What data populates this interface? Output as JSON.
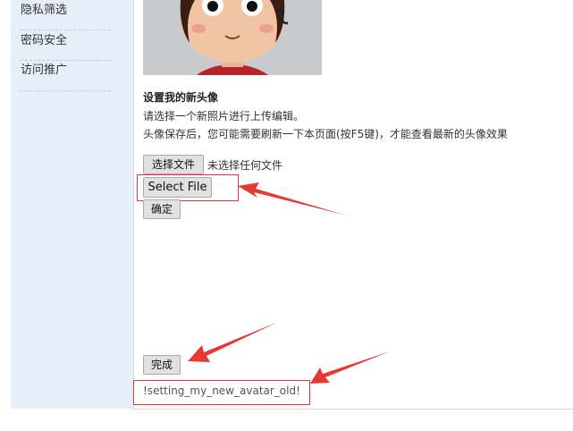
{
  "sidebar": {
    "items": [
      {
        "label": "隐私筛选"
      },
      {
        "label": "密码安全"
      },
      {
        "label": "访问推广"
      }
    ]
  },
  "avatar_section": {
    "heading": "设置我的新头像",
    "instruction": "请选择一个新照片进行上传编辑。",
    "note": "头像保存后，您可能需要刷新一下本页面(按F5键)，才能查看最新的头像效果"
  },
  "file_input": {
    "button_label": "选择文件",
    "status": "未选择任何文件"
  },
  "select_file_button": {
    "label": "Select File"
  },
  "confirm_button": {
    "label": "确定"
  },
  "done_button": {
    "label": "完成"
  },
  "placeholder_text": "!setting_my_new_avatar_old!",
  "colors": {
    "sidebar_bg": "#e6eef8",
    "annotation_red": "#e53935",
    "button_bg": "#e1e1e1"
  }
}
